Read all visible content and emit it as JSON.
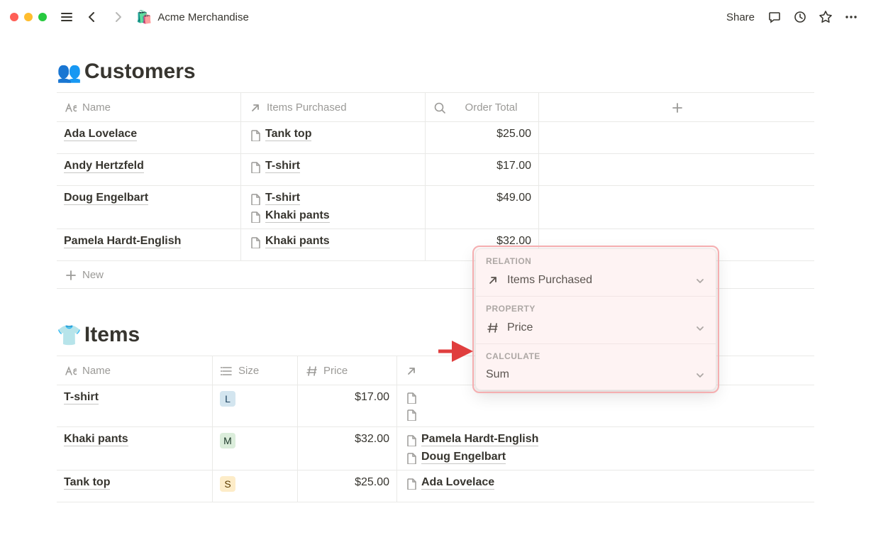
{
  "header": {
    "page_icon": "🛍️",
    "page_title": "Acme Merchandise",
    "share_label": "Share"
  },
  "customers": {
    "title_icon": "👥",
    "title": "Customers",
    "columns": {
      "name": "Name",
      "items_purchased": "Items Purchased",
      "order_total": "Order Total"
    },
    "rows": [
      {
        "name": "Ada Lovelace",
        "items": [
          "Tank top"
        ],
        "total": "$25.00"
      },
      {
        "name": "Andy Hertzfeld",
        "items": [
          "T-shirt"
        ],
        "total": "$17.00"
      },
      {
        "name": "Doug Engelbart",
        "items": [
          "T-shirt",
          "Khaki pants"
        ],
        "total": "$49.00"
      },
      {
        "name": "Pamela Hardt-English",
        "items": [
          "Khaki pants"
        ],
        "total": "$32.00"
      }
    ],
    "new_label": "New"
  },
  "items": {
    "title_icon": "👕",
    "title": "Items",
    "columns": {
      "name": "Name",
      "size": "Size",
      "price": "Price"
    },
    "rows": [
      {
        "name": "T-shirt",
        "size": "L",
        "size_class": "L",
        "price": "$17.00",
        "buyers": [
          "",
          ""
        ]
      },
      {
        "name": "Khaki pants",
        "size": "M",
        "size_class": "M",
        "price": "$32.00",
        "buyers": [
          "Pamela Hardt-English",
          "Doug Engelbart"
        ]
      },
      {
        "name": "Tank top",
        "size": "S",
        "size_class": "S",
        "price": "$25.00",
        "buyers": [
          "Ada Lovelace"
        ]
      }
    ]
  },
  "popover": {
    "relation_label": "RELATION",
    "relation_value": "Items Purchased",
    "property_label": "PROPERTY",
    "property_value": "Price",
    "calculate_label": "CALCULATE",
    "calculate_value": "Sum"
  }
}
